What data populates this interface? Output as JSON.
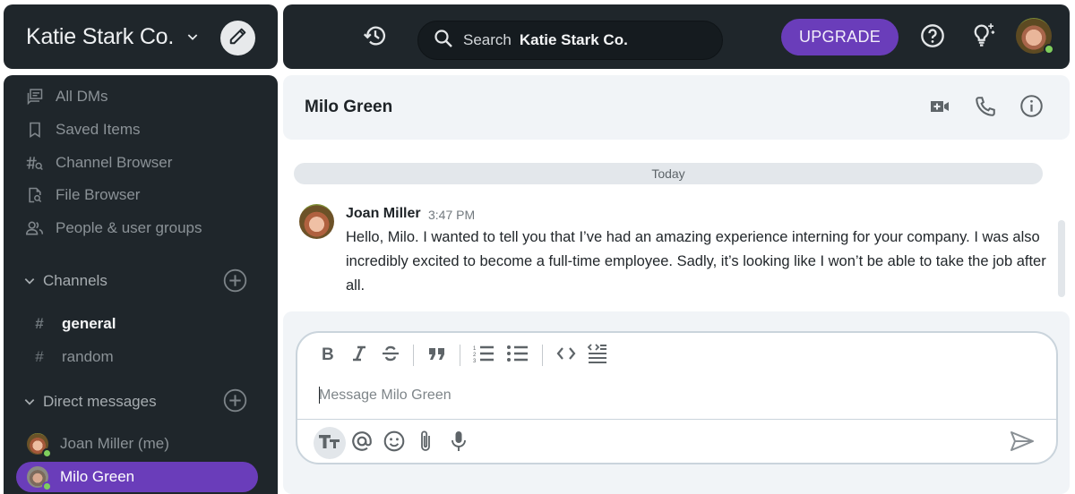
{
  "workspace": {
    "name": "Katie Stark Co.",
    "icons": {
      "chevron": "chevron-down-icon",
      "compose": "pencil-icon"
    }
  },
  "topbar": {
    "history_icon": "history-icon",
    "search": {
      "label": "Search",
      "scope": "Katie Stark Co.",
      "icon": "search-icon"
    },
    "upgrade_label": "UPGRADE",
    "help_icon": "help-circle-icon",
    "tips_icon": "lightbulb-sparkle-icon",
    "user_status": "online"
  },
  "sidebar": {
    "nav": [
      {
        "label": "All DMs",
        "icon": "chat-bubbles-icon"
      },
      {
        "label": "Saved Items",
        "icon": "bookmark-icon"
      },
      {
        "label": "Channel Browser",
        "icon": "channel-search-icon"
      },
      {
        "label": "File Browser",
        "icon": "file-search-icon"
      },
      {
        "label": "People & user groups",
        "icon": "people-icon"
      }
    ],
    "channels": {
      "header": "Channels",
      "items": [
        {
          "name": "general",
          "unread": true
        },
        {
          "name": "random",
          "unread": false
        }
      ]
    },
    "direct_messages": {
      "header": "Direct messages",
      "items": [
        {
          "name": "Joan Miller (me)",
          "status": "online",
          "active": false
        },
        {
          "name": "Milo Green",
          "status": "online",
          "active": true
        }
      ]
    }
  },
  "chat": {
    "title": "Milo Green",
    "header_icons": [
      "video-call-icon",
      "phone-icon",
      "info-icon"
    ],
    "date_divider": "Today",
    "messages": [
      {
        "author": "Joan Miller",
        "time": "3:47 PM",
        "text": "Hello, Milo. I wanted to tell you that I’ve had an amazing experience interning for your company. I was also incredibly excited to become a full-time employee. Sadly, it’s looking like I won’t be able to take the job after all."
      }
    ]
  },
  "composer": {
    "placeholder": "Message Milo Green",
    "value": "",
    "format_tools": [
      "bold-icon",
      "italic-icon",
      "strikethrough-icon",
      "quote-icon",
      "numbered-list-icon",
      "bulleted-list-icon",
      "code-icon",
      "code-block-icon"
    ],
    "actions": [
      "text-format-icon",
      "mention-icon",
      "emoji-icon",
      "attachment-icon",
      "microphone-icon"
    ],
    "send_icon": "send-icon"
  },
  "colors": {
    "accent": "#6a3dba",
    "sidebar_bg": "#1f262b",
    "online": "#7fcf5d",
    "panel_bg": "#f1f4f7"
  }
}
